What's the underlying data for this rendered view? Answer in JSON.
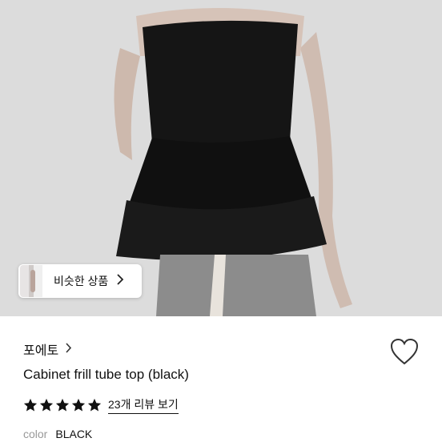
{
  "product": {
    "brand": "포에토",
    "title": "Cabinet frill tube top (black)",
    "rating": 5,
    "review_link": "23개 리뷰 보기",
    "option_label": "color",
    "option_value": "BLACK"
  },
  "similar_button": {
    "label": "비슷한 상품"
  },
  "icons": {
    "brand_chevron": "chevron-right-icon",
    "wishlist": "heart-outline-icon",
    "star": "star-filled-icon"
  },
  "colors": {
    "photo_background": "#d9d9d9",
    "garment": "#141414",
    "star": "#111111",
    "muted_text": "#999999"
  }
}
